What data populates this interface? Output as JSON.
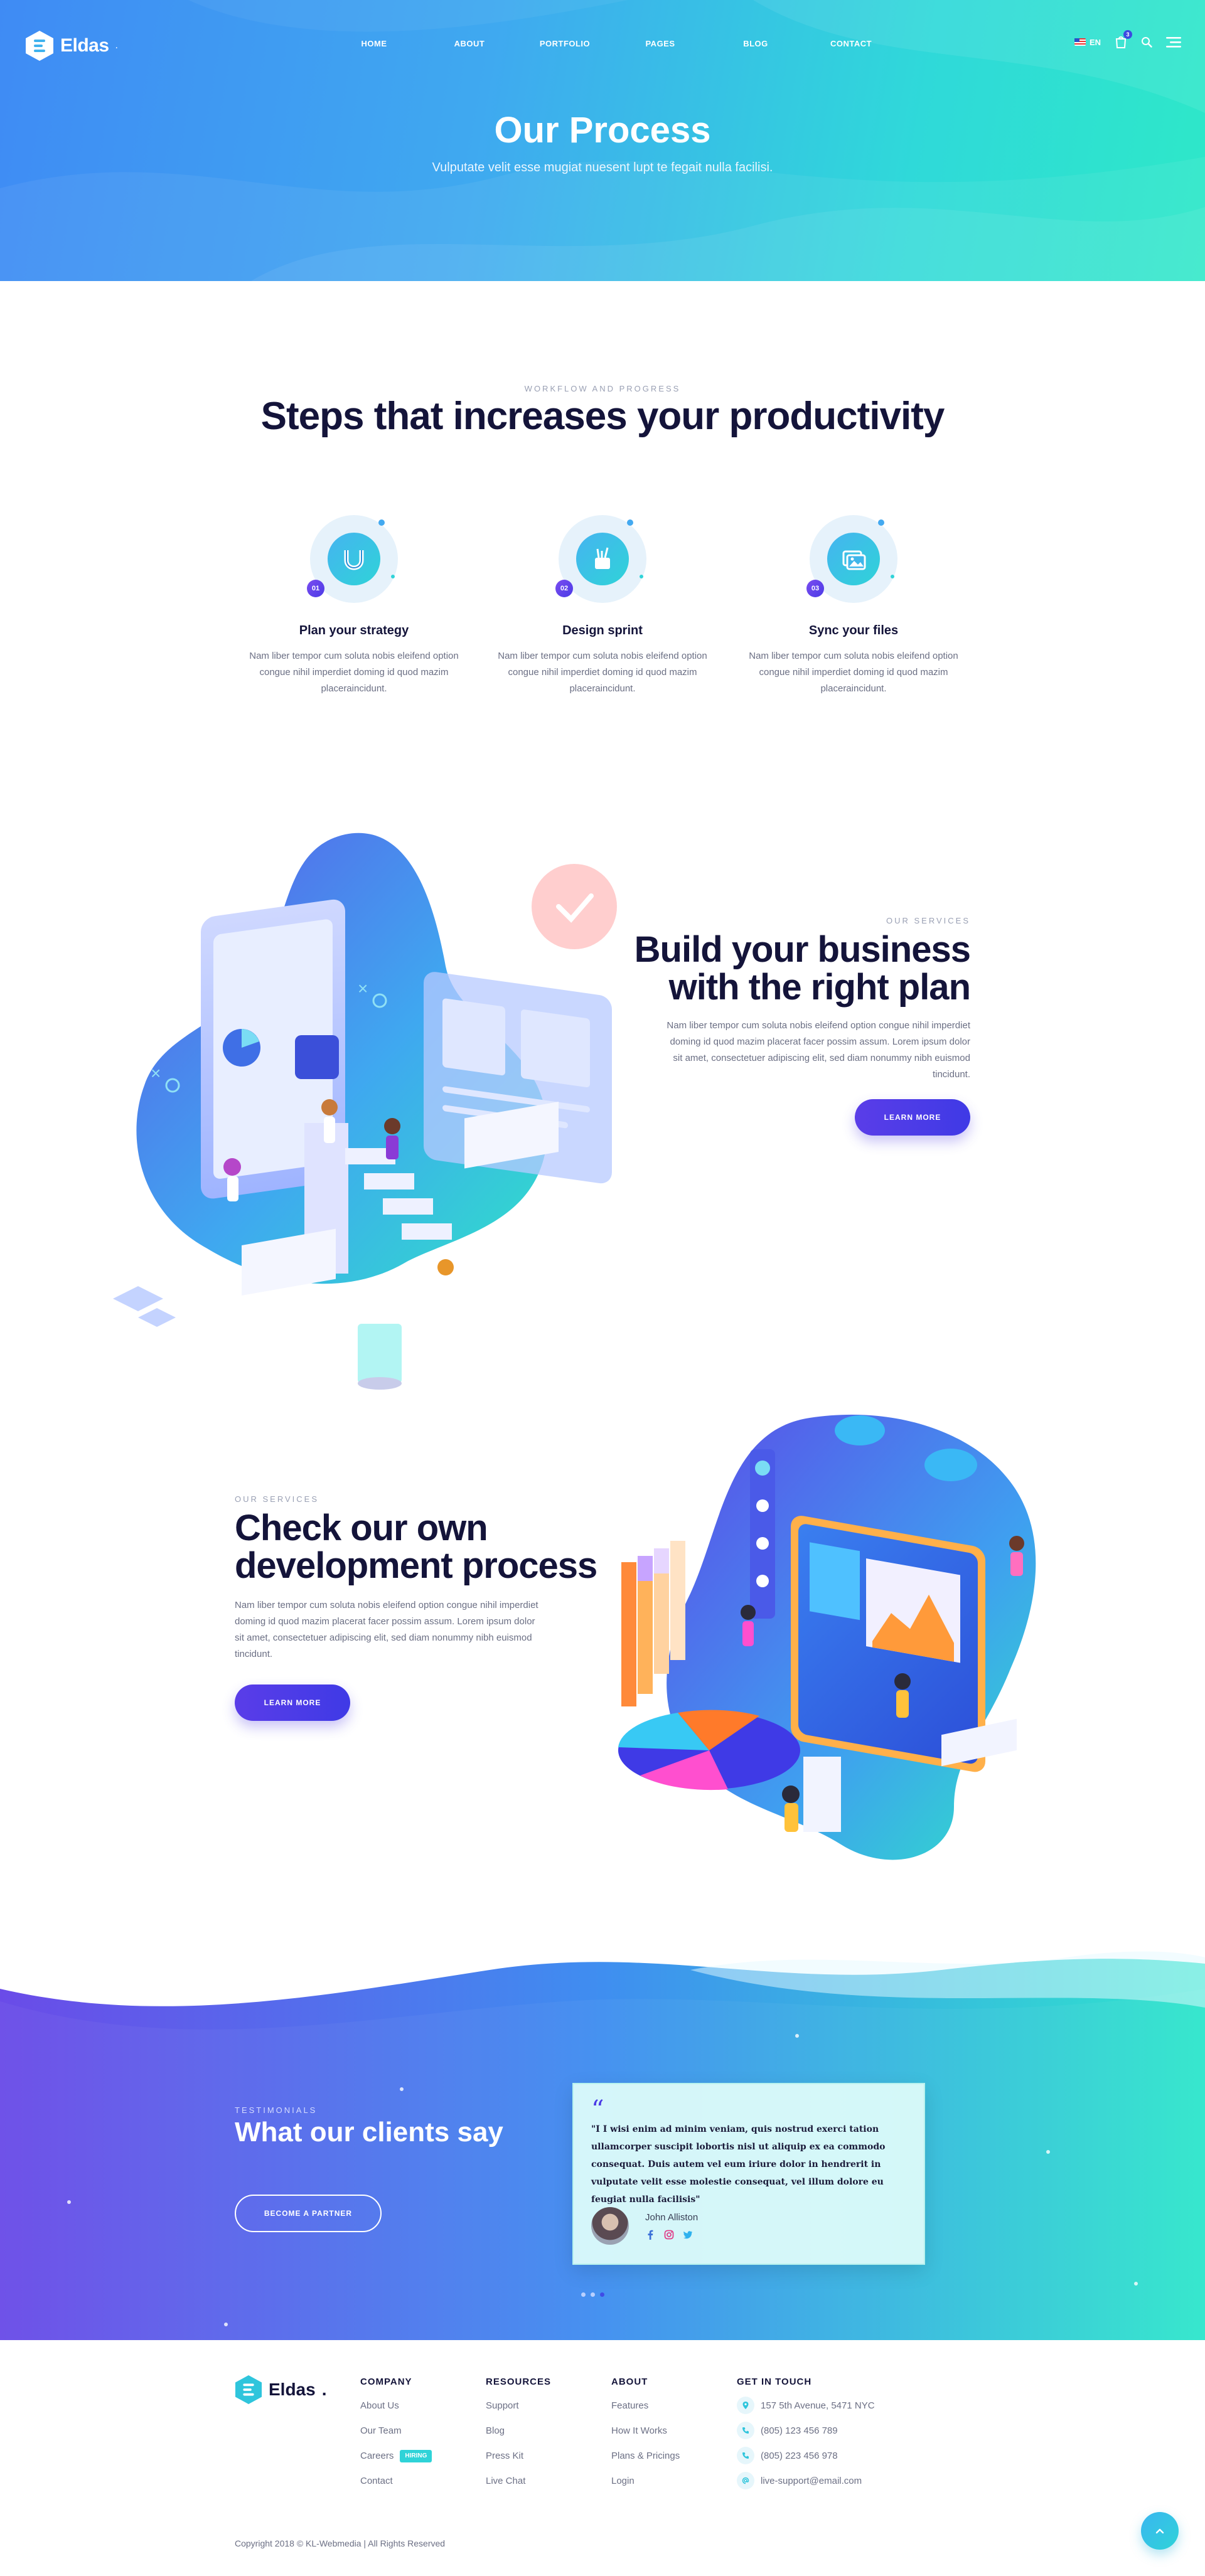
{
  "brand": {
    "name": "Eldas",
    "accent": "#4b3be6",
    "teal": "#2fd3d8",
    "blue": "#3f8bf4"
  },
  "nav": {
    "items": [
      "HOME",
      "ABOUT",
      "PORTFOLIO",
      "PAGES",
      "BLOG",
      "CONTACT"
    ]
  },
  "tools": {
    "lang": "EN",
    "cart_count": "3",
    "icons": [
      "flag-us-icon",
      "cart-icon",
      "search-icon",
      "hamburger-menu-icon"
    ]
  },
  "hero": {
    "title": "Our Process",
    "subtitle": "Vulputate velit esse mugiat nuesent lupt te fegait nulla facilisi."
  },
  "steps": {
    "kicker": "WORKFLOW AND PROGRESS",
    "title": "Steps that increases your productivity",
    "items": [
      {
        "num": "01",
        "icon": "magnet-icon",
        "title": "Plan your strategy",
        "text": "Nam liber tempor cum soluta nobis eleifend option congue nihil imperdiet doming id quod mazim placeraincidunt."
      },
      {
        "num": "02",
        "icon": "pen-cup-icon",
        "title": "Design sprint",
        "text": "Nam liber tempor cum soluta nobis eleifend option congue nihil imperdiet doming id quod mazim placeraincidunt."
      },
      {
        "num": "03",
        "icon": "image-gallery-icon",
        "title": "Sync your files",
        "text": "Nam liber tempor cum soluta nobis eleifend option congue nihil imperdiet doming id quod mazim placeraincidunt."
      }
    ]
  },
  "service1": {
    "kicker": "OUR SERVICES",
    "title_line1": "Build your business",
    "title_line2": "with the right plan",
    "text": "Nam liber tempor cum soluta nobis eleifend option congue nihil imperdiet doming id quod mazim placerat facer possim assum. Lorem ipsum dolor sit amet, consectetuer adipiscing elit, sed diam nonummy nibh euismod tincidunt.",
    "button": "LEARN MORE"
  },
  "service2": {
    "kicker": "OUR SERVICES",
    "title_line1": "Check our own",
    "title_line2": "development process",
    "text": "Nam liber tempor cum soluta nobis eleifend option congue nihil imperdiet doming id quod mazim placerat facer possim assum. Lorem ipsum dolor sit amet, consectetuer adipiscing elit, sed diam nonummy nibh euismod tincidunt.",
    "button": "LEARN MORE"
  },
  "testimonials": {
    "kicker": "TESTIMONIALS",
    "title": "What our clients say",
    "button": "BECOME A PARTNER",
    "quote_mark": "“",
    "quote": "\"I I wisi enim ad minim veniam, quis nostrud exerci tation ullamcorper suscipit lobortis nisl ut aliquip ex ea commodo consequat. Duis autem vel eum iriure dolor in hendrerit in vulputate velit esse molestie consequat, vel illum dolore eu feugiat nulla facilisis\"",
    "author": "John Alliston",
    "social": [
      "facebook-icon",
      "instagram-icon",
      "twitter-icon"
    ]
  },
  "footer": {
    "company": {
      "title": "COMPANY",
      "links": [
        "About Us",
        "Our Team",
        "Careers",
        "Contact"
      ],
      "hiring": "HIRING"
    },
    "resources": {
      "title": "RESOURCES",
      "links": [
        "Support",
        "Blog",
        "Press Kit",
        "Live Chat"
      ]
    },
    "about": {
      "title": "ABOUT",
      "links": [
        "Features",
        "How It Works",
        "Plans & Pricings",
        "Login"
      ]
    },
    "contact": {
      "title": "GET IN TOUCH",
      "address": "157 5th Avenue, 5471 NYC",
      "phone1": "(805) 123 456 789",
      "phone2": "(805) 223 456 978",
      "email": "live-support@email.com"
    },
    "copyright": "Copyright 2018 © KL-Webmedia | All Rights Reserved"
  }
}
